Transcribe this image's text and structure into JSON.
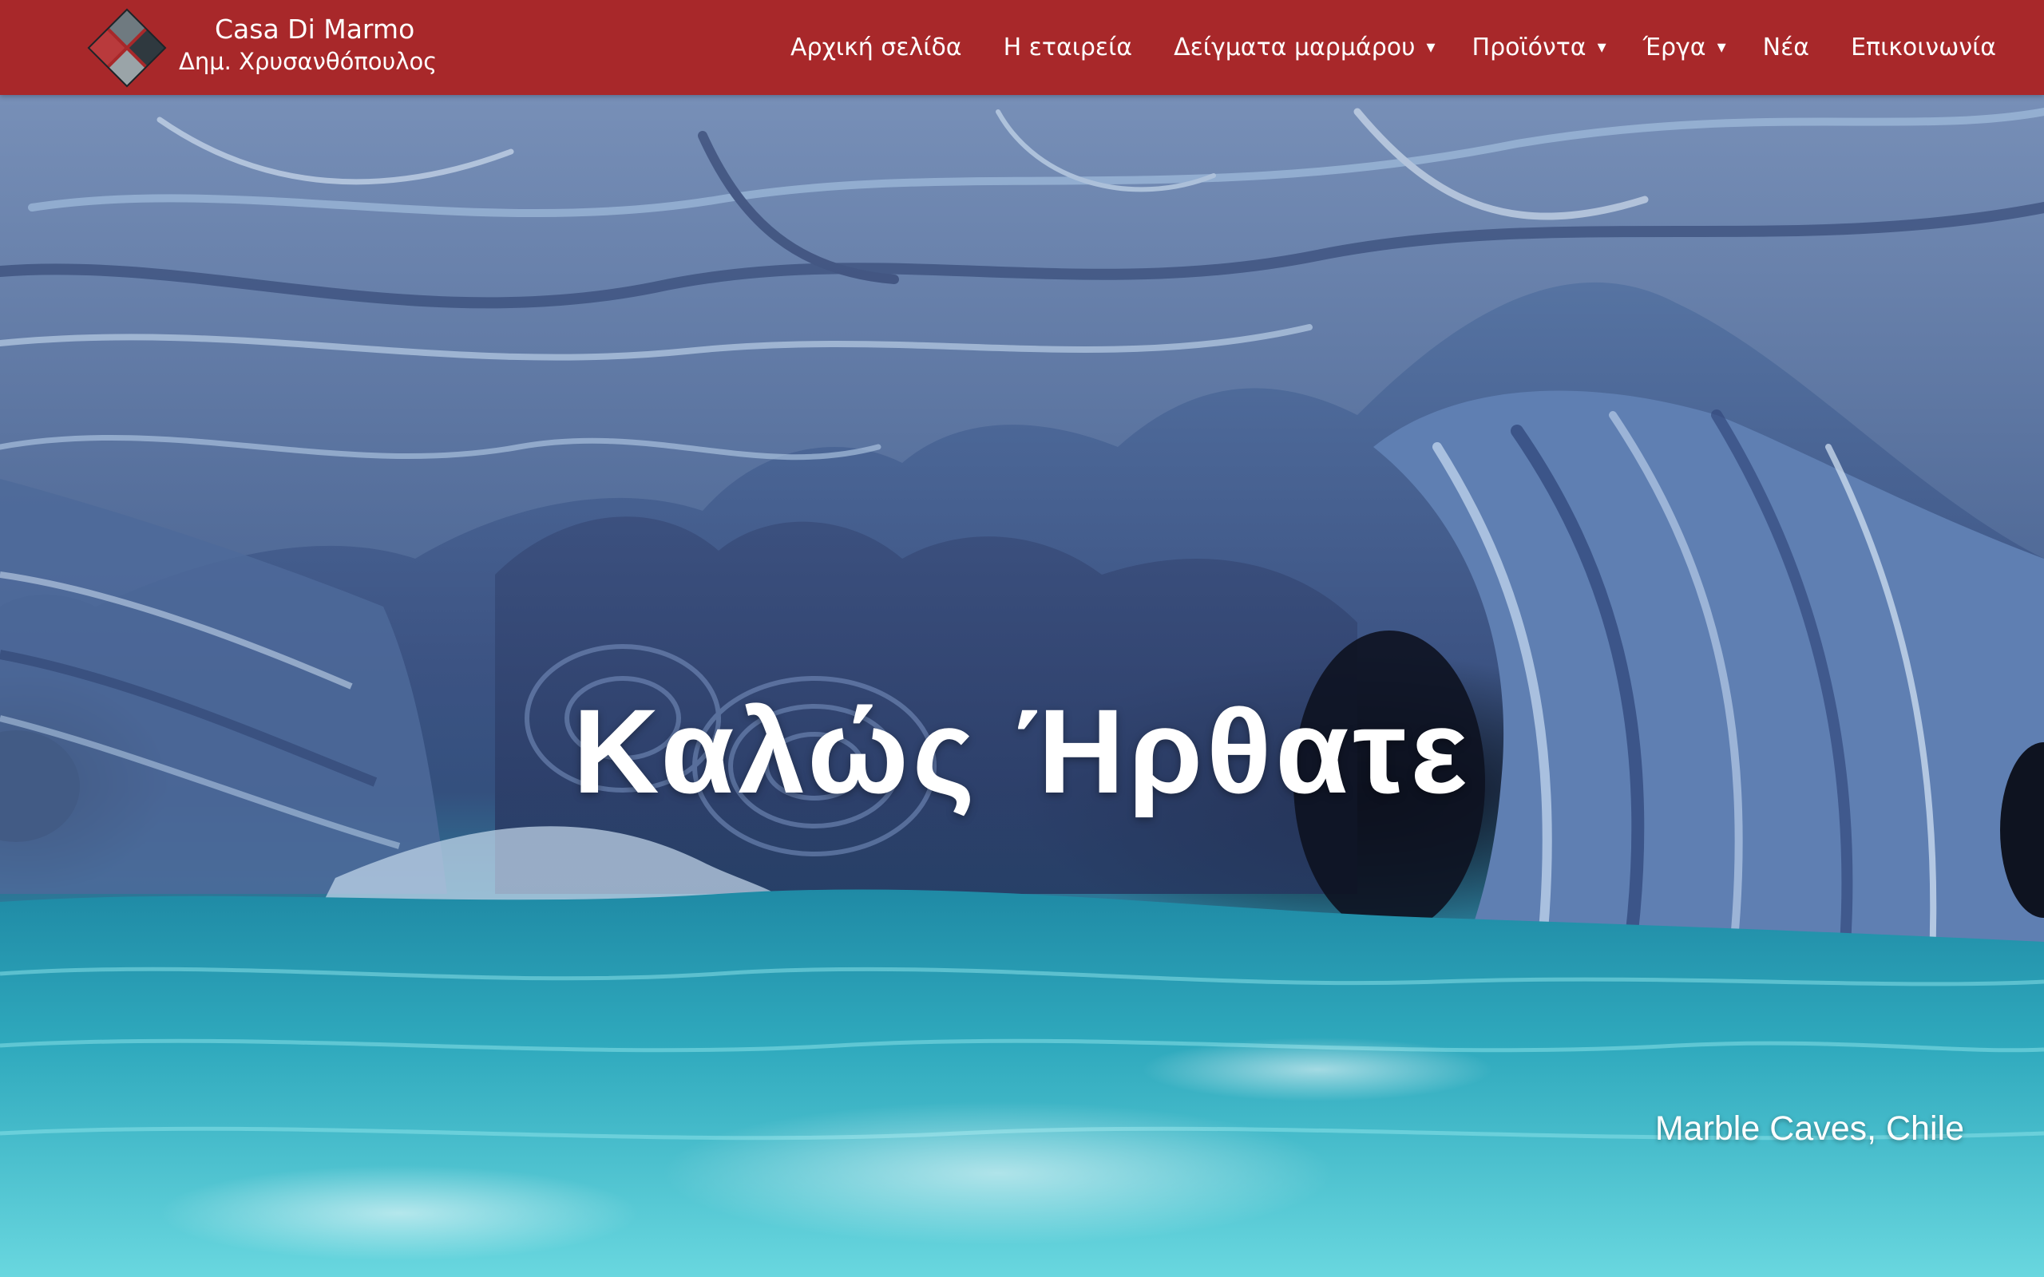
{
  "brand": {
    "name": "Casa Di Marmo",
    "owner": "Δημ. Χρυσανθόπουλος",
    "logo_icon": "marble-tiles-logo-icon"
  },
  "colors": {
    "header_bg": "#a8282a",
    "nav_text": "#ffffff",
    "hero_text": "#ffffff"
  },
  "nav": {
    "items": [
      {
        "label": "Αρχική σελίδα",
        "has_dropdown": false
      },
      {
        "label": "Η εταιρεία",
        "has_dropdown": false
      },
      {
        "label": "Δείγματα μαρμάρου",
        "has_dropdown": true
      },
      {
        "label": "Προϊόντα",
        "has_dropdown": true
      },
      {
        "label": "Έργα",
        "has_dropdown": true
      },
      {
        "label": "Νέα",
        "has_dropdown": false
      },
      {
        "label": "Επικοινωνία",
        "has_dropdown": false
      }
    ],
    "dropdown_icon": "caret-down-icon",
    "dropdown_glyph": "▾"
  },
  "hero": {
    "title": "Καλώς Ήρθατε",
    "caption": "Marble Caves, Chile",
    "background_image": "marble-cave-photo"
  }
}
